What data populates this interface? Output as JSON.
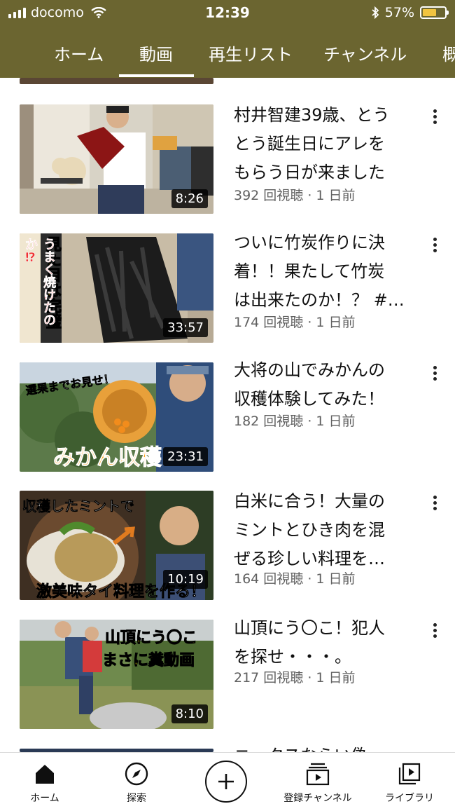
{
  "status_bar": {
    "carrier": "docomo",
    "time": "12:39",
    "battery": "57%"
  },
  "tabs": [
    "ホーム",
    "動画",
    "再生リスト",
    "チャンネル",
    "概"
  ],
  "active_tab": "動画",
  "videos": [
    {
      "title_lines": [
        "村井智建39歳、とう",
        "とう誕生日にアレを",
        "もらう日が来ました"
      ],
      "meta": "392 回視聴 · 1 日前",
      "duration": "8:26"
    },
    {
      "title_lines": [
        "ついに竹炭作りに決",
        "着！！果たして竹炭",
        "は出来たのか！？ #…"
      ],
      "meta": "174 回視聴 · 1 日前",
      "duration": "33:57",
      "thumb_text": [
        "見た目は完璧",
        "うまく焼けたのか⁉"
      ]
    },
    {
      "title_lines": [
        "大将の山でみかんの",
        "収穫体験してみた！"
      ],
      "meta": "182 回視聴 · 1 日前",
      "duration": "23:31",
      "thumb_text": [
        "選果までお見せ！",
        "みかん収穫"
      ]
    },
    {
      "title_lines": [
        "白米に合う！大量の",
        "ミントとひき肉を混",
        "ぜる珍しい料理を…"
      ],
      "meta": "164 回視聴 · 1 日前",
      "duration": "10:19",
      "thumb_text": [
        "収穫したミントで",
        "激美味タイ料理を作る！"
      ]
    },
    {
      "title_lines": [
        "山頂にう〇こ！犯人",
        "を探せ・・・。"
      ],
      "meta": "217 回視聴 · 1 日前",
      "duration": "8:10",
      "thumb_text": [
        "山頂にう〇こ",
        "まさに糞動画"
      ]
    },
    {
      "title_lines": [
        "ニ…クスならい偽"
      ]
    }
  ],
  "bottom_nav": {
    "home": "ホーム",
    "explore": "探索",
    "subscriptions": "登録チャンネル",
    "library": "ライブラリ"
  },
  "colors": {
    "header": "#6b6530",
    "meta": "#606060",
    "battery": "#f2c440"
  },
  "icons": [
    "signal-icon",
    "wifi-icon",
    "bluetooth-icon",
    "battery-icon",
    "more-vert-icon",
    "home-icon",
    "compass-icon",
    "add-icon",
    "subscriptions-icon",
    "library-icon"
  ]
}
